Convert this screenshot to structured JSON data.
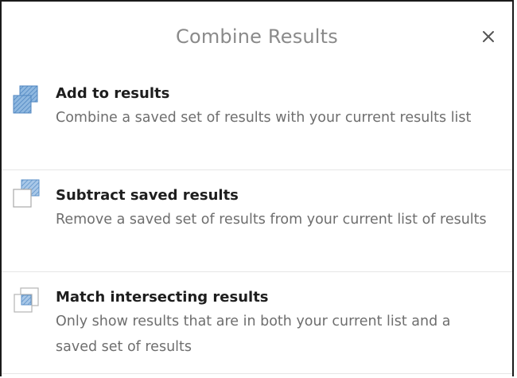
{
  "dialog": {
    "title": "Combine Results",
    "close_icon": "close-icon"
  },
  "options": [
    {
      "icon": "add-results-icon",
      "title": "Add to results",
      "description": "Combine a saved set of results with your current results list"
    },
    {
      "icon": "subtract-results-icon",
      "title": "Subtract saved results",
      "description": "Remove a saved set of results from your current list of results"
    },
    {
      "icon": "intersect-results-icon",
      "title": "Match intersecting results",
      "description": "Only show results that are in both your current list and a saved set of results"
    }
  ],
  "colors": {
    "icon_blue": "#6f9fd0",
    "icon_outline": "#a9a9a9",
    "title_text": "#8a8a8a",
    "option_title": "#1e1e1e",
    "option_desc": "#6e6e6e"
  }
}
